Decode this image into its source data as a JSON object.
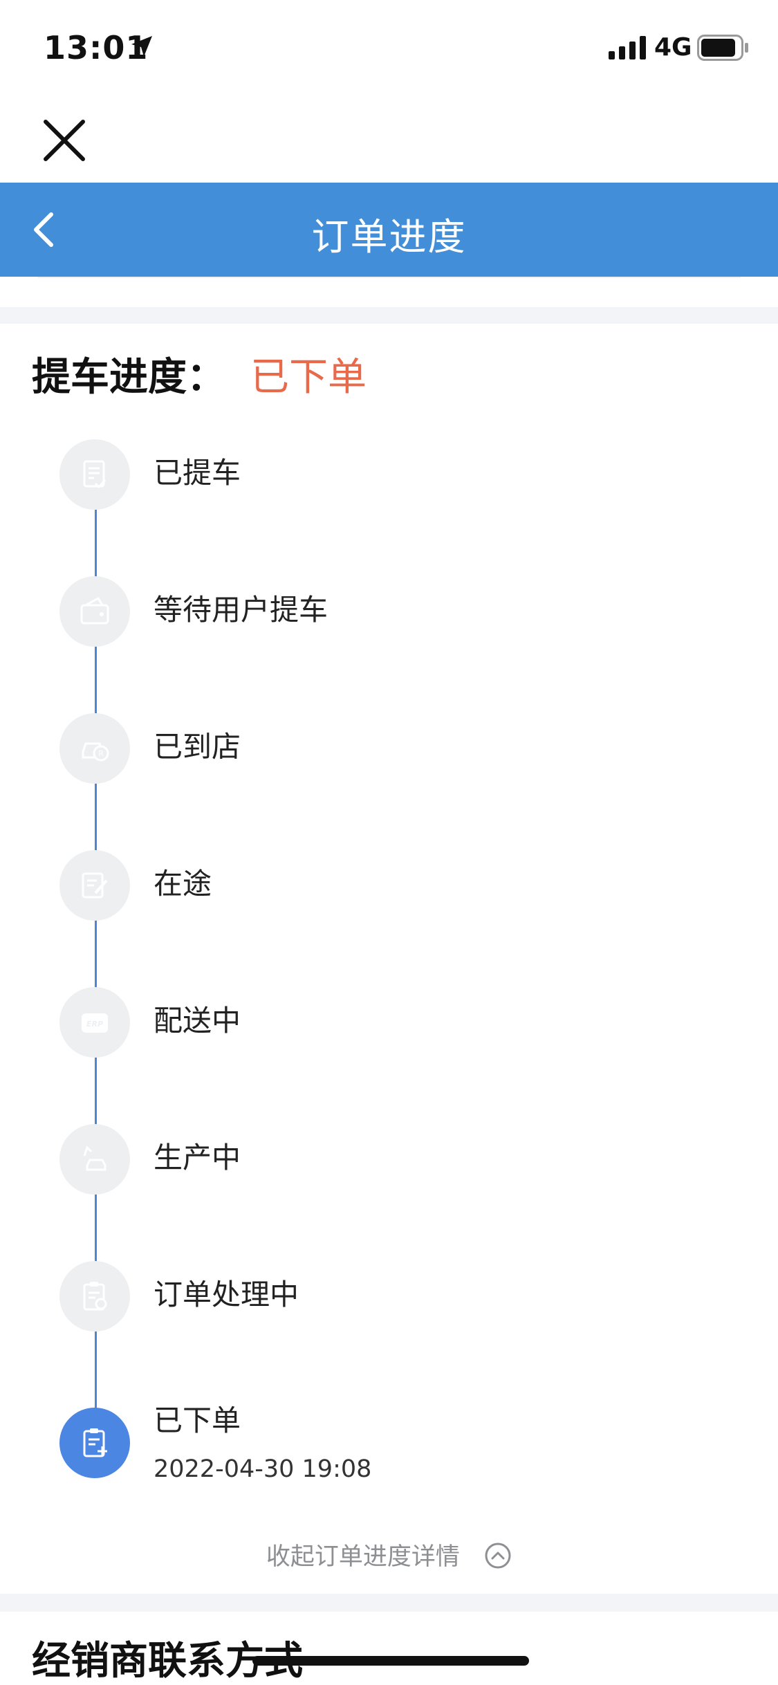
{
  "status_bar": {
    "time": "13:01",
    "network": "4G"
  },
  "header": {
    "title": "订单进度"
  },
  "progress": {
    "label": "提车进度：",
    "value": "已下单"
  },
  "timeline": [
    {
      "label": "已提车",
      "icon": "document-check-icon",
      "active": false
    },
    {
      "label": "等待用户提车",
      "icon": "wallet-icon",
      "active": false
    },
    {
      "label": "已到店",
      "icon": "car-service-icon",
      "active": false
    },
    {
      "label": "在途",
      "icon": "edit-document-icon",
      "active": false
    },
    {
      "label": "配送中",
      "icon": "erp-truck-icon",
      "active": false
    },
    {
      "label": "生产中",
      "icon": "factory-car-icon",
      "active": false
    },
    {
      "label": "订单处理中",
      "icon": "clipboard-clock-icon",
      "active": false
    },
    {
      "label": "已下单",
      "icon": "clipboard-plus-icon",
      "active": true,
      "date": "2022-04-30 19:08"
    }
  ],
  "collapse": {
    "label": "收起订单进度详情"
  },
  "dealer": {
    "title": "经销商联系方式"
  },
  "colors": {
    "brand": "#428ed9",
    "accent": "#e86a4b",
    "active_step": "#4a86e2"
  }
}
